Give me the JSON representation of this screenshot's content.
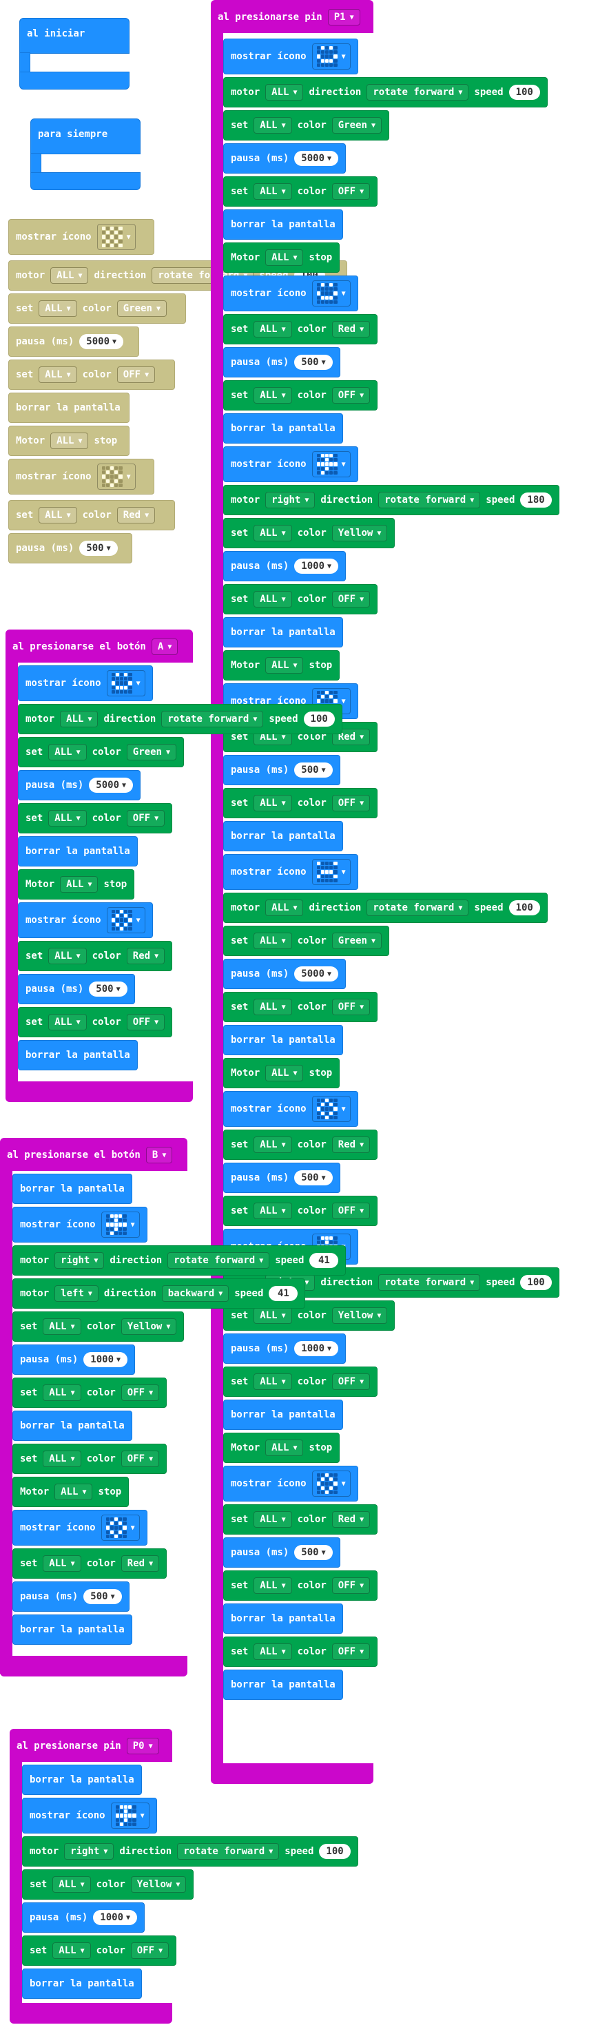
{
  "labels": {
    "on_start": "al iniciar",
    "forever": "para siempre",
    "on_pin_pressed": "al presionarse pin",
    "on_button_pressed": "al presionarse el botón",
    "show_icon": "mostrar ícono",
    "motor": "motor",
    "motor_stop_word": "Motor",
    "direction": "direction",
    "speed": "speed",
    "stop": "stop",
    "set": "set",
    "color": "color",
    "pause": "pausa (ms)",
    "clear": "borrar la pantalla",
    "caret": "▼"
  },
  "values": {
    "ALL": "ALL",
    "right": "right",
    "left": "left",
    "forward": "rotate forward",
    "backward": "backward",
    "Green": "Green",
    "Red": "Red",
    "Yellow": "Yellow",
    "OFF": "OFF",
    "v100": "100",
    "v180": "180",
    "v41": "41",
    "v5000": "5000",
    "v500": "500",
    "v1000": "1000",
    "P1": "P1",
    "P0": "P0",
    "A": "A",
    "B": "B"
  },
  "colors": {
    "event": "#cb07cb",
    "basic": "#1e90ff",
    "robot": "#00a44e",
    "ghost": "#c8c28a"
  },
  "icons": {
    "happy": [
      0,
      1,
      0,
      1,
      0,
      0,
      0,
      0,
      0,
      0,
      1,
      0,
      0,
      0,
      1,
      0,
      1,
      1,
      1,
      0,
      0,
      0,
      0,
      0,
      0
    ],
    "diamond": [
      0,
      0,
      1,
      0,
      0,
      0,
      1,
      0,
      1,
      0,
      1,
      0,
      0,
      0,
      1,
      0,
      1,
      0,
      1,
      0,
      0,
      0,
      1,
      0,
      0
    ],
    "arrow": [
      0,
      1,
      1,
      1,
      0,
      0,
      0,
      1,
      0,
      0,
      1,
      1,
      1,
      1,
      1,
      0,
      0,
      1,
      0,
      0,
      0,
      1,
      0,
      0,
      0
    ],
    "sad": [
      1,
      0,
      0,
      0,
      1,
      0,
      0,
      0,
      0,
      0,
      0,
      1,
      1,
      1,
      0,
      1,
      0,
      0,
      0,
      1,
      0,
      0,
      0,
      0,
      0
    ],
    "checker": [
      1,
      0,
      1,
      0,
      1,
      0,
      1,
      0,
      1,
      0,
      1,
      0,
      1,
      0,
      1,
      0,
      1,
      0,
      1,
      0,
      1,
      0,
      1,
      0,
      1
    ]
  }
}
